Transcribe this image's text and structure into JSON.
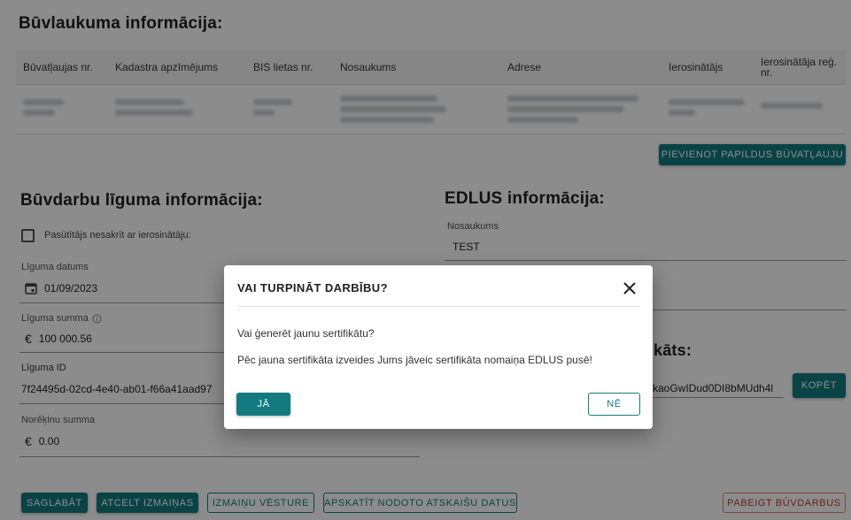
{
  "construction_site": {
    "title": "Būvlaukuma informācija:",
    "columns": [
      "Būvatļaujas nr.",
      "Kadastra apzīmējums",
      "BIS lietas nr.",
      "Nosaukums",
      "Adrese",
      "Ierosinātājs",
      "Ierosinātāja reģ. nr."
    ],
    "add_permit_button": "Pievienot papildus būvatļauju"
  },
  "contract": {
    "title": "Būvdarbu līguma informācija:",
    "checkbox_label": "Pasūtītājs nesakrīt ar ierosinātāju:",
    "date_label": "Līguma datums",
    "date_value": "01/09/2023",
    "sum_label": "Līguma summa",
    "sum_value": "100 000.56",
    "id_label": "Līguma ID",
    "id_value": "7f24495d-02cd-4e40-ab01-f66a41aad97",
    "settlement_label": "Norēķinu summa",
    "settlement_value": "0.00",
    "currency_symbol": "€"
  },
  "edlus": {
    "title": "EDLUS informācija:",
    "name_label": "Nosaukums",
    "name_value": "TEST",
    "cert_title_partial": "kāts:",
    "cert_value_partial": "kaoGwIDud0DI8bMUdh4l",
    "copy_button": "Kopēt"
  },
  "actions": {
    "save": "Saglabāt",
    "cancel_changes": "Atcelt izmaiņas",
    "history": "Izmaiņu vēsture",
    "view_reports": "Apskatīt nodoto atskaišu datus",
    "finish": "Pabeigt būvdarbus"
  },
  "dialog": {
    "title": "VAI TURPINĀT DARBĪBU?",
    "question": "Vai ģenerēt jaunu sertifikātu?",
    "warning": "Pēc jauna sertifikāta izveides Jums jāveic sertifikāta nomaiņa EDLUS pusē!",
    "yes": "Jā",
    "no": "Nē"
  },
  "colors": {
    "accent": "#137b80",
    "danger": "#c0392b"
  }
}
